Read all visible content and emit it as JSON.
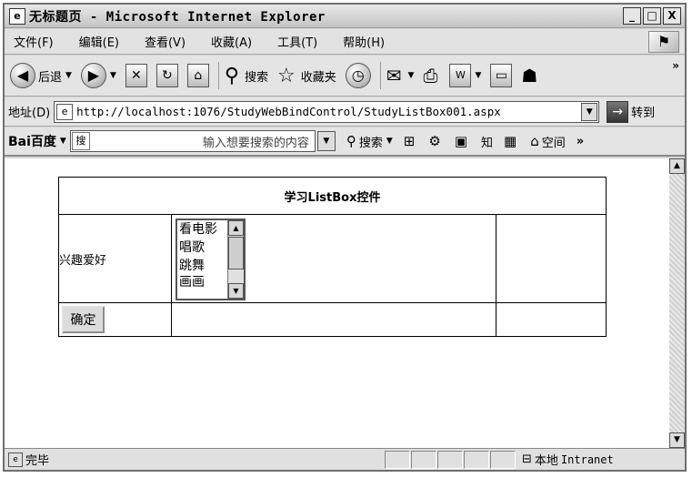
{
  "window": {
    "title": "无标题页 - Microsoft Internet Explorer",
    "buttons": {
      "minimize": "_",
      "maximize": "□",
      "close": "X"
    }
  },
  "menubar": {
    "items": [
      "文件(F)",
      "编辑(E)",
      "查看(V)",
      "收藏(A)",
      "工具(T)",
      "帮助(H)"
    ]
  },
  "toolbar": {
    "back": "后退",
    "search": "搜索",
    "favorites": "收藏夹"
  },
  "addressbar": {
    "label": "地址(D)",
    "url": "http://localhost:1076/StudyWebBindControl/StudyListBox001.aspx",
    "go": "转到"
  },
  "baidubar": {
    "logo": "Bai百度",
    "placeholder": "输入想要搜索的内容",
    "search": "搜索",
    "know": "知",
    "space": "空间"
  },
  "page": {
    "heading": "学习ListBox控件",
    "label": "兴趣爱好",
    "listbox_options": [
      "看电影",
      "唱歌",
      "跳舞",
      "画画"
    ],
    "ok_button": "确定"
  },
  "statusbar": {
    "text": "完毕",
    "zone": "本地",
    "zone_name": "Intranet"
  },
  "icons": {
    "back": "back-arrow-icon",
    "forward": "forward-arrow-icon",
    "stop": "stop-icon",
    "refresh": "refresh-icon",
    "home": "home-icon",
    "search": "magnifier-icon",
    "favorites": "star-icon",
    "history": "history-icon",
    "mail": "mail-icon",
    "print": "printer-icon",
    "word": "word-icon",
    "discuss": "discuss-icon",
    "messenger": "messenger-icon"
  }
}
